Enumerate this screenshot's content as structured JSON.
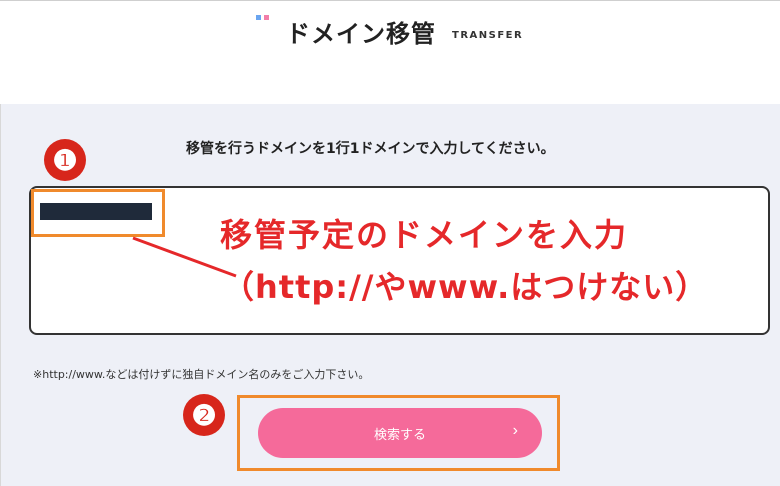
{
  "header": {
    "title": "ドメイン移管",
    "subtitle": "TRANSFER"
  },
  "instruction": "移管を行うドメインを1行1ドメインで入力してください。",
  "annotations": {
    "step1": "❶",
    "step2": "❷",
    "note_line1": "移管予定のドメインを入力",
    "note_line2": "（http://やwww.はつけない）"
  },
  "hint": "※http://www.などは付けずに独自ドメイン名のみをご入力下さい。",
  "search_button": {
    "label": "検索する",
    "chevron": "›"
  },
  "colors": {
    "accent_pink": "#f56a9a",
    "annotation_red": "#e5282a",
    "annotation_orange": "#f08a2c",
    "panel_bg": "#eef0f7"
  }
}
